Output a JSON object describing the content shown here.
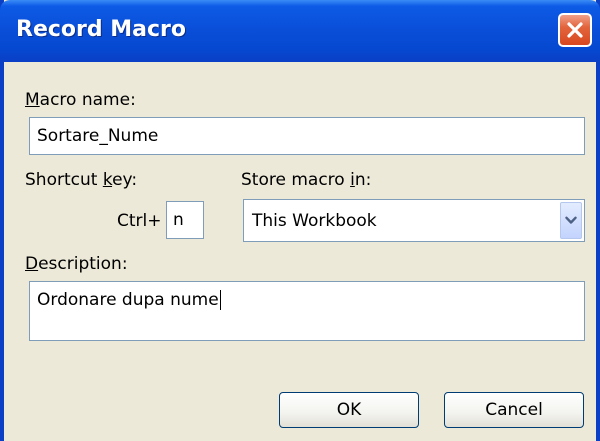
{
  "window": {
    "title": "Record Macro",
    "close_icon": "close-icon"
  },
  "macro_name": {
    "label_hotkey": "M",
    "label_rest": "acro name:",
    "value": "Sortare_Nume"
  },
  "shortcut": {
    "label_pre": "Shortcut ",
    "label_hotkey": "k",
    "label_post": "ey:",
    "prefix": "Ctrl+",
    "value": "n"
  },
  "store": {
    "label_pre": "Store macro ",
    "label_hotkey": "i",
    "label_post": "n:",
    "selected": "This Workbook",
    "dropdown_icon": "chevron-down-icon"
  },
  "description": {
    "label_hotkey": "D",
    "label_rest": "escription:",
    "value": "Ordonare dupa nume"
  },
  "buttons": {
    "ok": "OK",
    "cancel": "Cancel"
  }
}
